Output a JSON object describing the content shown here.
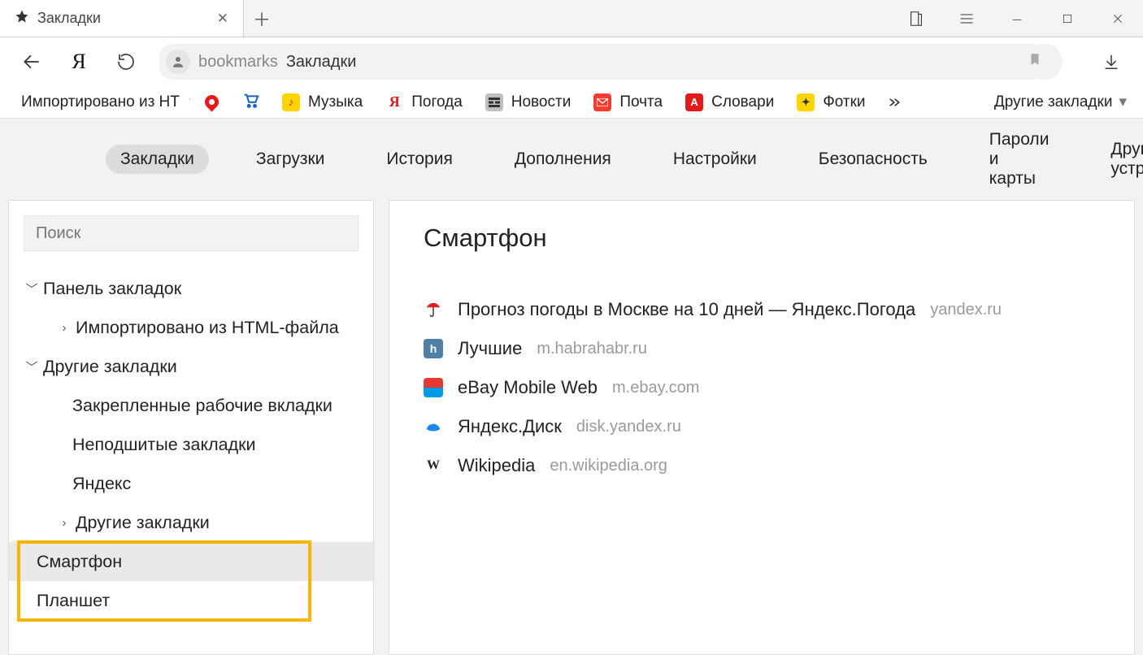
{
  "title_bar": {
    "tab_title": "Закладки"
  },
  "address": {
    "segment_dim": "bookmarks",
    "segment_main": "Закладки"
  },
  "bookmarks_bar": {
    "imported_label": "Импортировано из HT",
    "items": [
      {
        "label": "Музыка"
      },
      {
        "label": "Погода"
      },
      {
        "label": "Новости"
      },
      {
        "label": "Почта"
      },
      {
        "label": "Словари"
      },
      {
        "label": "Фотки"
      }
    ],
    "other_label": "Другие закладки"
  },
  "section_tabs": [
    "Закладки",
    "Загрузки",
    "История",
    "Дополнения",
    "Настройки",
    "Безопасность",
    "Пароли и карты",
    "Другие устройства"
  ],
  "sidebar": {
    "search_placeholder": "Поиск",
    "tree": {
      "panel_label": "Панель закладок",
      "imported_label": "Импортировано из HTML-файла",
      "other_label": "Другие закладки",
      "other_children": [
        "Закрепленные рабочие вкладки",
        "Неподшитые закладки",
        "Яндекс",
        "Другие закладки"
      ],
      "devices": [
        "Смартфон",
        "Планшет"
      ]
    }
  },
  "main": {
    "heading": "Смартфон",
    "bookmarks": [
      {
        "title": "Прогноз погоды в Москве на 10 дней — Яндекс.Погода",
        "domain": "yandex.ru"
      },
      {
        "title": "Лучшие",
        "domain": "m.habrahabr.ru"
      },
      {
        "title": "eBay Mobile Web",
        "domain": "m.ebay.com"
      },
      {
        "title": "Яндекс.Диск",
        "domain": "disk.yandex.ru"
      },
      {
        "title": "Wikipedia",
        "domain": "en.wikipedia.org"
      }
    ]
  }
}
